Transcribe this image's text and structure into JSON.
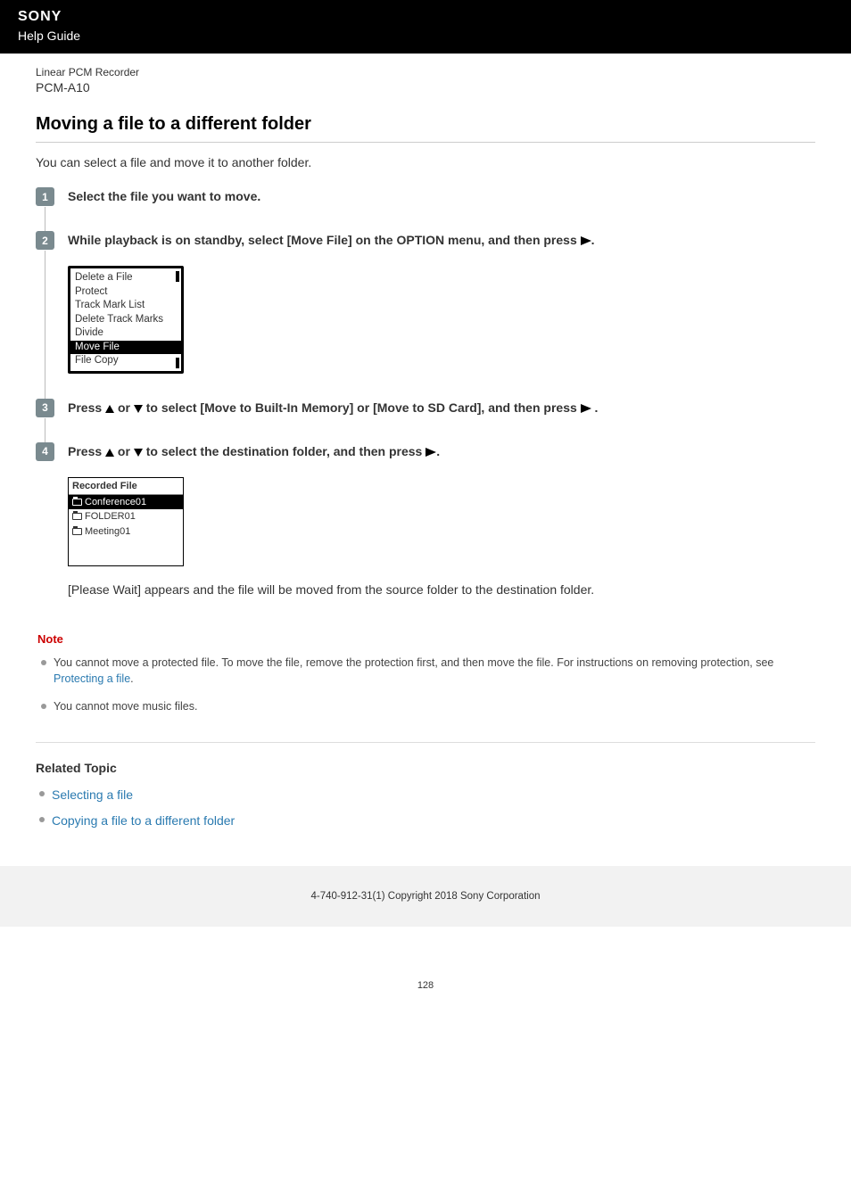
{
  "header": {
    "brand": "SONY",
    "help_guide": "Help Guide"
  },
  "product": {
    "category": "Linear PCM Recorder",
    "model": "PCM-A10"
  },
  "page": {
    "title": "Moving a file to a different folder",
    "intro": "You can select a file and move it to another folder."
  },
  "steps": [
    {
      "num": "1",
      "title": "Select the file you want to move."
    },
    {
      "num": "2",
      "title_pre": "While playback is on standby, select [Move File] on the OPTION menu, and then press ",
      "title_post": ".",
      "menu": {
        "items": [
          "Delete a File",
          "Protect",
          "Track Mark List",
          "Delete Track Marks",
          "Divide",
          "Move File",
          "File Copy"
        ],
        "selected_index": 5
      }
    },
    {
      "num": "3",
      "title_seg1": "Press ",
      "title_seg2": " or ",
      "title_seg3": " to select [Move to Built-In Memory] or [Move to SD Card], and then press ",
      "title_seg4": "."
    },
    {
      "num": "4",
      "title_seg1": "Press ",
      "title_seg2": " or ",
      "title_seg3": " to select the destination folder, and then press ",
      "title_seg4": ".",
      "menu": {
        "header": "Recorded File",
        "items": [
          "Conference01",
          "FOLDER01",
          "Meeting01"
        ],
        "selected_index": 0
      },
      "body": "[Please Wait] appears and the file will be moved from the source folder to the destination folder."
    }
  ],
  "note": {
    "heading": "Note",
    "items": [
      {
        "pre": "You cannot move a protected file. To move the file, remove the protection first, and then move the file. For instructions on removing protection, see ",
        "link": "Protecting a file",
        "post": "."
      },
      {
        "pre": "You cannot move music files."
      }
    ]
  },
  "related": {
    "heading": "Related Topic",
    "links": [
      "Selecting a file",
      "Copying a file to a different folder"
    ]
  },
  "footer": {
    "copyright": "4-740-912-31(1) Copyright 2018 Sony Corporation"
  },
  "page_number": "128"
}
